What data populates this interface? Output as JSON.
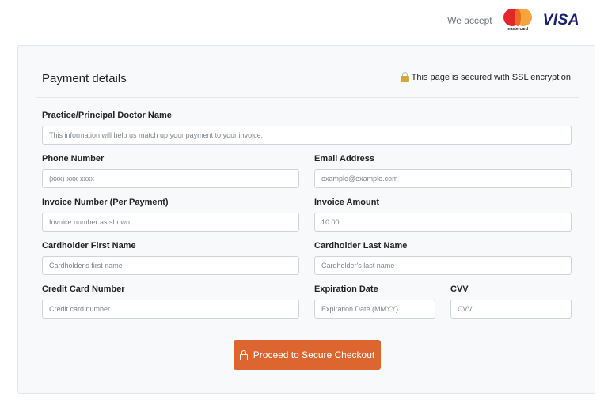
{
  "header": {
    "we_accept": "We accept",
    "mastercard_label": "mastercard",
    "visa_label": "VISA"
  },
  "card": {
    "title": "Payment details",
    "ssl_notice": "This page is secured with SSL encryption"
  },
  "fields": {
    "practice": {
      "label": "Practice/Principal Doctor Name",
      "placeholder": "This information will help us match up your payment to your invoice.",
      "value": ""
    },
    "phone": {
      "label": "Phone Number",
      "placeholder": "(xxx)-xxx-xxxx",
      "value": ""
    },
    "email": {
      "label": "Email Address",
      "placeholder": "example@example.com",
      "value": ""
    },
    "invoice_number": {
      "label": "Invoice Number (Per Payment)",
      "placeholder": "Invoice number as shown",
      "value": ""
    },
    "invoice_amount": {
      "label": "Invoice Amount",
      "placeholder": "10.00",
      "value": ""
    },
    "first_name": {
      "label": "Cardholder First Name",
      "placeholder": "Cardholder's first name",
      "value": ""
    },
    "last_name": {
      "label": "Cardholder Last Name",
      "placeholder": "Cardholder's last name",
      "value": ""
    },
    "card_number": {
      "label": "Credit Card Number",
      "placeholder": "Credit card number",
      "value": ""
    },
    "expiration": {
      "label": "Expiration Date",
      "placeholder": "Expiration Date (MMYY)",
      "value": ""
    },
    "cvv": {
      "label": "CVV",
      "placeholder": "CVV",
      "value": ""
    }
  },
  "submit": {
    "label": "Proceed to Secure Checkout"
  },
  "colors": {
    "accent": "#dd6630",
    "lock": "#d4a73a",
    "visa": "#1a1f71"
  }
}
